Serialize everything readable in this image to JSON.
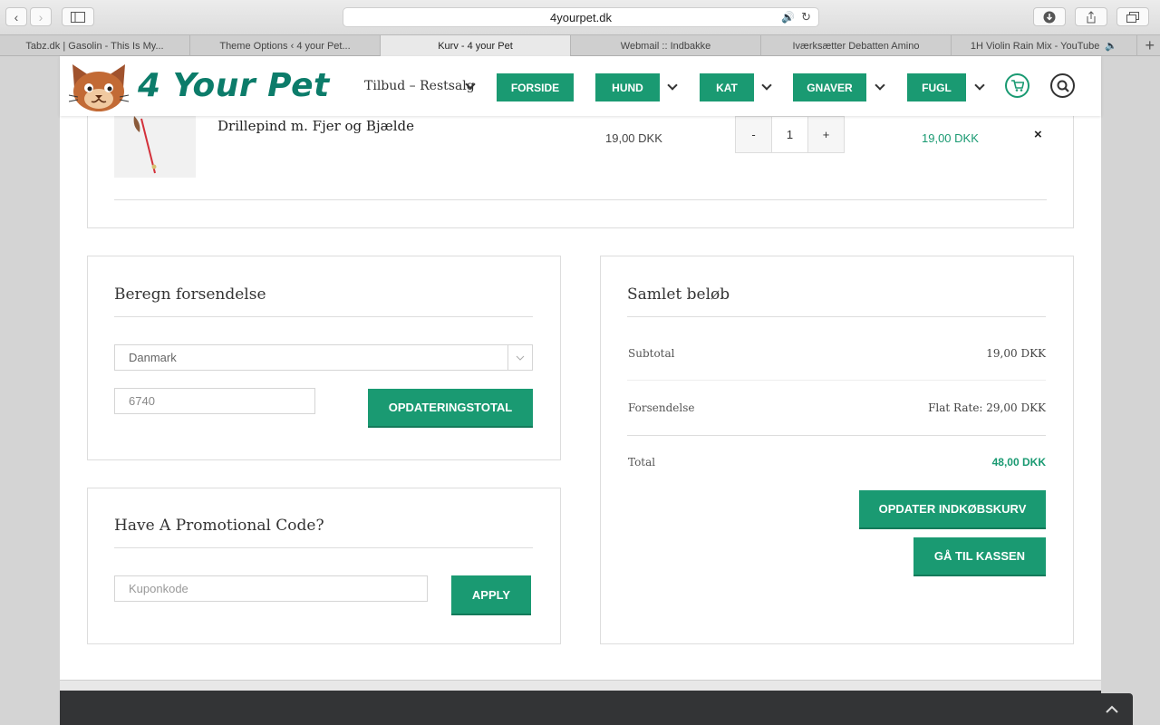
{
  "browser": {
    "url": "4yourpet.dk",
    "tabs": [
      "Tabz.dk | Gasolin - This Is My...",
      "Theme Options ‹ 4 your Pet...",
      "Kurv - 4 your Pet",
      "Webmail :: Indbakke",
      "Iværksætter Debatten Amino",
      "1H Violin Rain Mix - YouTube"
    ]
  },
  "header": {
    "logo_text": "4 Your Pet",
    "nav": {
      "tilbud": "Tilbud – Restsalg",
      "forside": "FORSIDE",
      "hund": "HUND",
      "kat": "KAT",
      "gnaver": "GNAVER",
      "fugl": "FUGL"
    }
  },
  "cart": {
    "item": {
      "name": "Drillepind m. Fjer og Bjælde",
      "price": "19,00 DKK",
      "qty_minus": "-",
      "qty": "1",
      "qty_plus": "+",
      "line_total": "19,00 DKK",
      "remove": "×"
    }
  },
  "shipping": {
    "title": "Beregn forsendelse",
    "country": "Danmark",
    "postcode": "6740",
    "button": "OPDATERINGSTOTAL"
  },
  "promo": {
    "title": "Have A Promotional Code?",
    "placeholder": "Kuponkode",
    "button": "APPLY"
  },
  "totals": {
    "title": "Samlet beløb",
    "subtotal_label": "Subtotal",
    "subtotal_value": "19,00 DKK",
    "shipping_label": "Forsendelse",
    "shipping_value": "Flat Rate: 29,00 DKK",
    "total_label": "Total",
    "total_value": "48,00 DKK",
    "update_button": "OPDATER INDKØBSKURV",
    "checkout_button": "GÅ TIL KASSEN"
  },
  "colors": {
    "accent": "#1a9a72",
    "logo": "#0c7c6a"
  }
}
